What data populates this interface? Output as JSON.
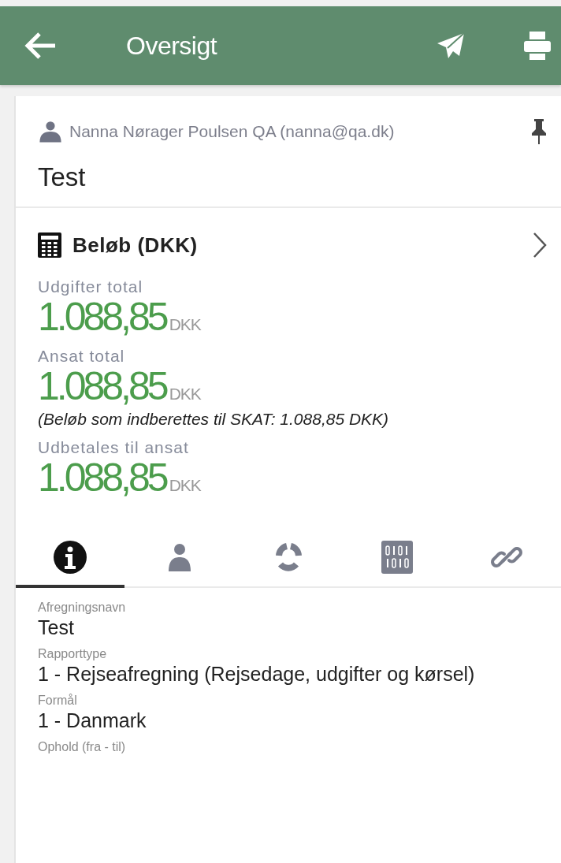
{
  "header": {
    "title": "Oversigt"
  },
  "report": {
    "owner": "Nanna Nørager Poulsen QA (nanna@qa.dk)",
    "name": "Test"
  },
  "amounts": {
    "title": "Beløb (DKK)",
    "items": [
      {
        "label": "Udgifter total",
        "value": "1.088,85",
        "currency": "DKK"
      },
      {
        "label": "Ansat total",
        "value": "1.088,85",
        "currency": "DKK",
        "note": "(Beløb som indberettes til SKAT: 1.088,85 DKK)"
      },
      {
        "label": "Udbetales til ansat",
        "value": "1.088,85",
        "currency": "DKK"
      }
    ]
  },
  "tabs": [
    {
      "kind": "info",
      "selected": true
    },
    {
      "kind": "person",
      "selected": false
    },
    {
      "kind": "cycle",
      "selected": false
    },
    {
      "kind": "binary",
      "selected": false
    },
    {
      "kind": "link",
      "selected": false
    }
  ],
  "fields": [
    {
      "label": "Afregningsnavn",
      "value": "Test"
    },
    {
      "label": "Rapporttype",
      "value": "1 - Rejseafregning (Rejsedage, udgifter og kørsel)"
    },
    {
      "label": "Formål",
      "value": "1 - Danmark"
    },
    {
      "label": "Ophold (fra - til)"
    }
  ]
}
